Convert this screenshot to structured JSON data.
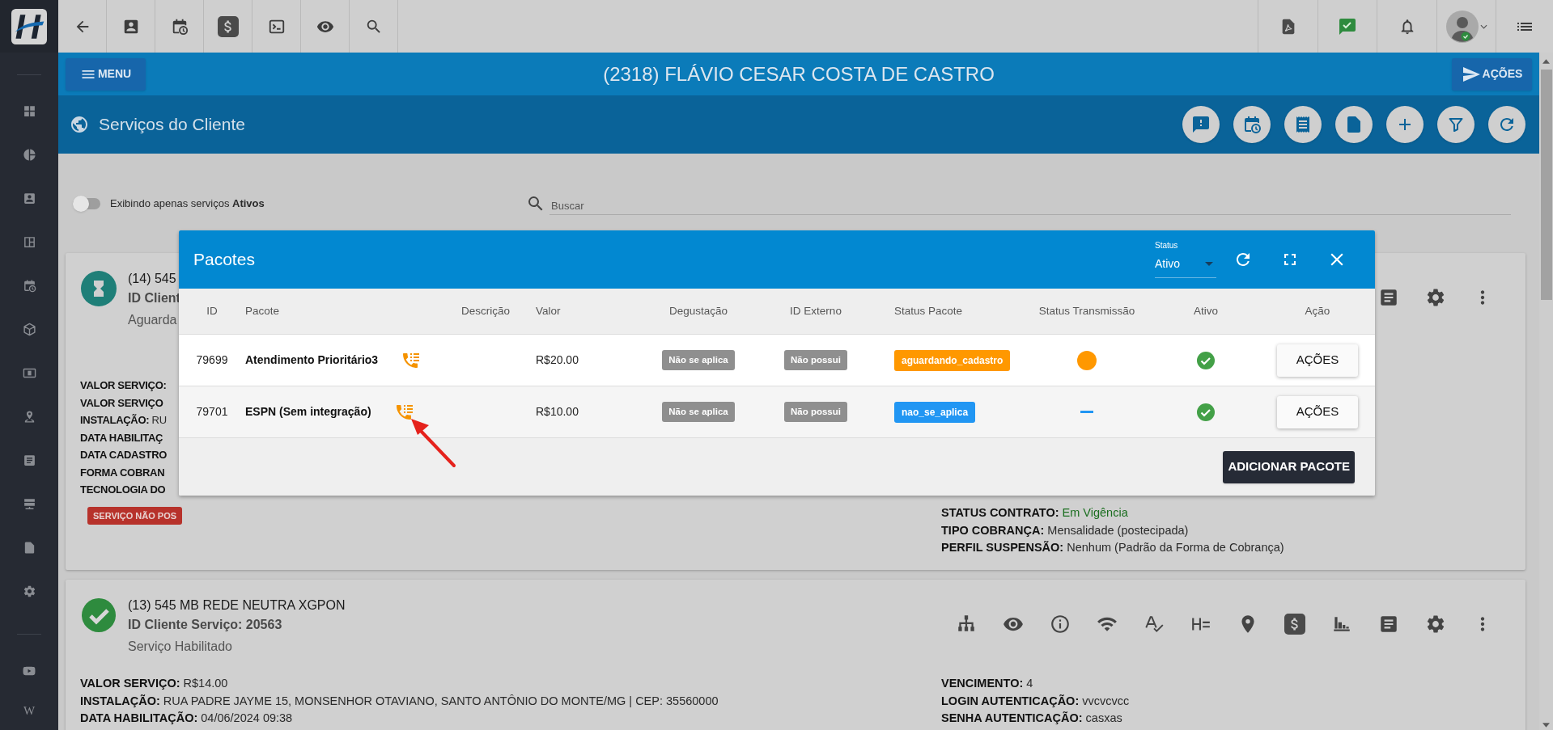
{
  "sidebar": {
    "footer_glyph": "W"
  },
  "header": {
    "title": "(2318) FLÁVIO CESAR COSTA DE CASTRO",
    "menu_button": "MENU",
    "actions_button": "AÇÕES"
  },
  "section": {
    "title": "Serviços do Cliente"
  },
  "filter": {
    "toggle_on": false,
    "toggle_label": "Exibindo apenas serviços **Ativos**",
    "search_placeholder": "Buscar"
  },
  "services": [
    {
      "kind": "pending",
      "title": "(14) 545",
      "client_id": "ID Client",
      "status": "Aguarda",
      "details_left": [
        {
          "label": "VALOR SERVIÇO:"
        },
        {
          "label": "VALOR SERVIÇO"
        },
        {
          "label": "INSTALAÇÃO:",
          "value": "RU"
        },
        {
          "label": "DATA HABILITAÇ"
        },
        {
          "label": "DATA CADASTRO"
        },
        {
          "label": "FORMA COBRAN"
        },
        {
          "label": "TECNOLOGIA DO"
        }
      ],
      "badge": "SERVIÇO NÃO POS",
      "details_right": [
        {
          "label": "STATUS CONTRATO:",
          "value": "Em Vigência",
          "positive": true
        },
        {
          "label": "TIPO COBRANÇA:",
          "value": "Mensalidade (postecipada)",
          "positive": false
        },
        {
          "label": "PERFIL SUSPENSÃO:",
          "value": "Nenhum (Padrão da Forma de Cobrança)",
          "positive": false
        }
      ]
    },
    {
      "kind": "enabled",
      "title": "(13) 545 MB REDE NEUTRA XGPON",
      "client_id": "ID Cliente Serviço: 20563",
      "status": "Serviço Habilitado",
      "details_left": [
        {
          "label": "VALOR SERVIÇO:",
          "value": "R$14.00"
        },
        {
          "label": "INSTALAÇÃO:",
          "value": "RUA PADRE JAYME 15, MONSENHOR OTAVIANO, SANTO ANTÔNIO DO MONTE/MG | CEP: 35560000"
        },
        {
          "label": "DATA HABILITAÇÃO:",
          "value": "04/06/2024 09:38"
        }
      ],
      "details_right": [
        {
          "label": "VENCIMENTO:",
          "value": "4",
          "positive": false
        },
        {
          "label": "LOGIN AUTENTICAÇÃO:",
          "value": "vvcvcvcc",
          "positive": false
        },
        {
          "label": "SENHA AUTENTICAÇÃO:",
          "value": "casxas",
          "positive": false
        }
      ]
    }
  ],
  "packages_dialog": {
    "title": "Pacotes",
    "status_label": "Status",
    "status_value": "Ativo",
    "columns": [
      "ID",
      "Pacote",
      "Descrição",
      "Valor",
      "Degustação",
      "ID Externo",
      "Status Pacote",
      "Status Transmissão",
      "Ativo",
      "Ação"
    ],
    "rows": [
      {
        "id": "79699",
        "name": "Atendimento Prioritário3",
        "value": "R$20.00",
        "trial": "Não se aplica",
        "external_id": "Não possui",
        "status": {
          "text": "aguardando_cadastro",
          "color": "#ff9800"
        },
        "transmission": {
          "kind": "dot",
          "color": "#ff9800"
        },
        "active": true,
        "action": "AÇÕES"
      },
      {
        "id": "79701",
        "name": "ESPN (Sem integração)",
        "value": "R$10.00",
        "trial": "Não se aplica",
        "external_id": "Não possui",
        "status": {
          "text": "nao_se_aplica",
          "color": "#2196f3"
        },
        "transmission": {
          "kind": "dash",
          "color": "#2196f3"
        },
        "active": true,
        "action": "AÇÕES"
      }
    ],
    "add_button": "ADICIONAR PACOTE"
  }
}
